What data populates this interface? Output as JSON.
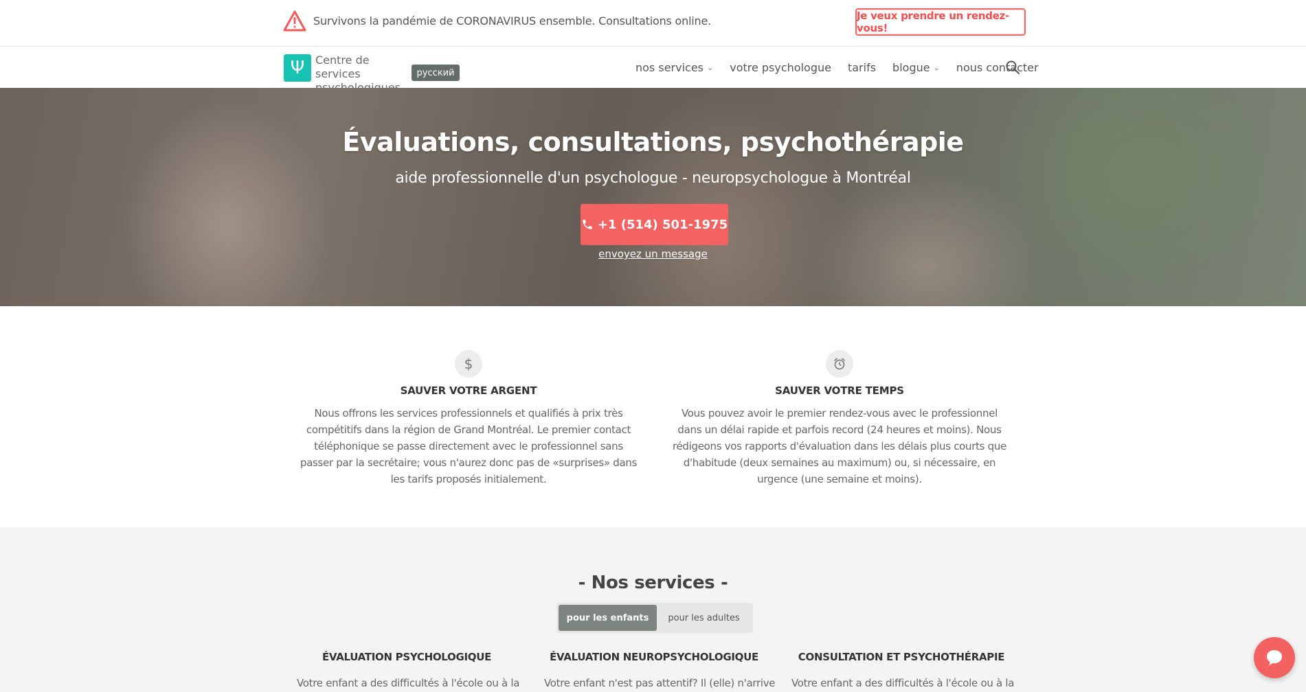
{
  "alert": {
    "icon": "warning-triangle-icon",
    "text": "Survivons la pandémie de CORONAVIRUS ensemble. Consultations online.",
    "button_label": "Je veux prendre un rendez-vous!",
    "accent_color": "#ef4f4f"
  },
  "navbar": {
    "logo_symbol": "Ψ",
    "logo_color": "#19c3b4",
    "logo_line1": "Centre de services",
    "logo_line2": "psychologiques",
    "lang_badge": "русский",
    "links": [
      {
        "label": "nos services",
        "dropdown": true
      },
      {
        "label": "votre psychologue",
        "dropdown": false
      },
      {
        "label": "tarifs",
        "dropdown": false
      },
      {
        "label": "blogue",
        "dropdown": true
      },
      {
        "label": "nous contacter",
        "dropdown": false
      }
    ],
    "search_icon": "search-icon"
  },
  "hero": {
    "title": "Évaluations, consultations, psychothérapie",
    "subtitle": "aide professionnelle d'un psychologue - neuropsychologue à Montréal",
    "phone_label": "+1 (514) 501-1975",
    "message_link": "envoyez un message",
    "button_color": "#f56262"
  },
  "features": [
    {
      "icon": "dollar-icon",
      "icon_glyph": "$",
      "title": "SAUVER VOTRE ARGENT",
      "text": "Nous offrons les services professionnels et qualifiés à prix très compétitifs dans la région de Grand Montréal. Le premier contact téléphonique se passe directement avec le professionnel sans passer par la secrétaire; vous n'aurez donc pas de «surprises» dans les tarifs proposés initialement."
    },
    {
      "icon": "alarm-clock-icon",
      "icon_glyph": "⏰",
      "title": "SAUVER VOTRE TEMPS",
      "text": "Vous pouvez avoir le premier rendez-vous avec le professionnel dans un délai rapide et parfois record (24 heures et moins). Nous rédigeons vos rapports d'évaluation dans les délais plus courts que d'habitude (deux semaines au maximum) ou, si nécessaire, en urgence (une semaine et moins)."
    }
  ],
  "services": {
    "title": "- Nos services -",
    "tabs": [
      {
        "label": "pour les enfants",
        "active": true
      },
      {
        "label": "pour les adultes",
        "active": false
      }
    ],
    "columns": [
      {
        "title": "ÉVALUATION PSYCHOLOGIQUE",
        "text": "Votre enfant a des difficultés à l'école ou à la"
      },
      {
        "title": "ÉVALUATION NEUROPSYCHOLOGIQUE",
        "text": "Votre enfant n'est pas attentif? Il (elle) n'arrive"
      },
      {
        "title": "CONSULTATION ET PSYCHOTHÉRAPIE",
        "text": "Votre enfant a des difficultés à l'école ou à la"
      }
    ]
  },
  "chat": {
    "icon": "chat-bubble-icon",
    "color": "#f36161"
  }
}
